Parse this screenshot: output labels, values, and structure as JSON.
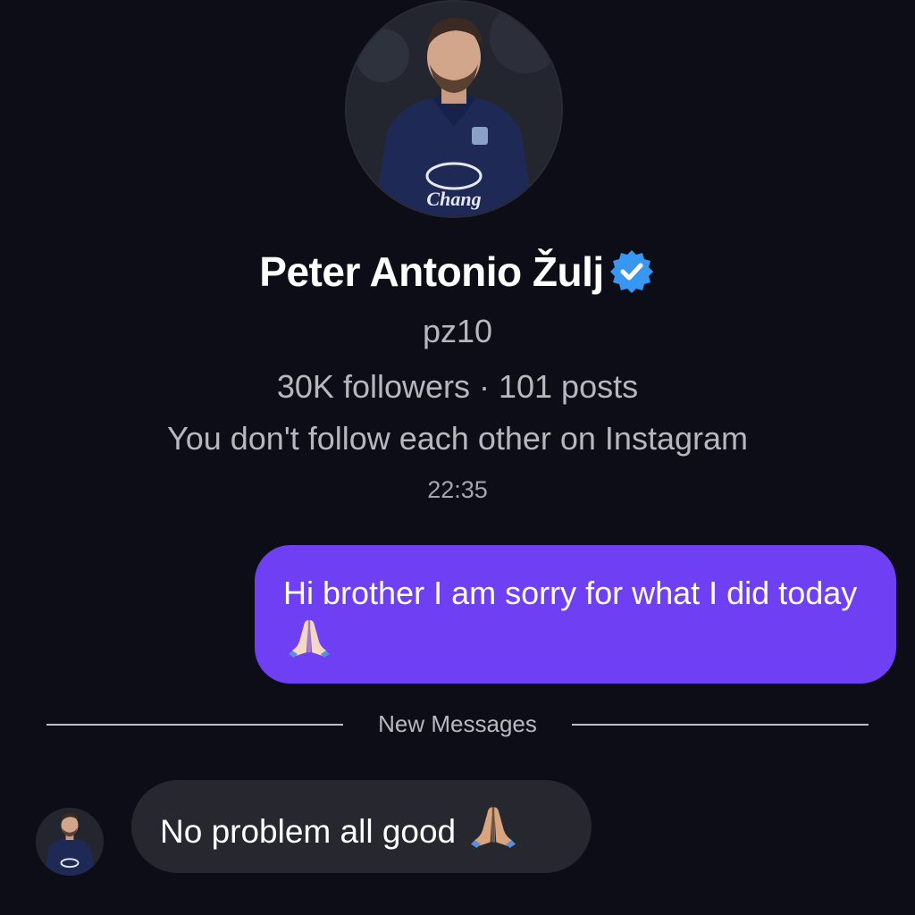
{
  "profile": {
    "name": "Peter Antonio Žulj",
    "verified": true,
    "username": "pz10",
    "stats": "30K followers · 101 posts",
    "follow_status": "You don't follow each other on Instagram"
  },
  "thread": {
    "timestamp": "22:35",
    "new_messages_label": "New Messages",
    "messages": [
      {
        "direction": "sent",
        "text": "Hi brother I am sorry for what I did today",
        "emoji": "folded-hands"
      },
      {
        "direction": "received",
        "text": "No problem all good",
        "emoji": "folded-hands"
      }
    ]
  },
  "colors": {
    "background": "#0c0d16",
    "sent_bubble": "#6e3ff3",
    "received_bubble": "#26272f",
    "verified_badge": "#3897f0",
    "secondary_text": "#b7b8be"
  }
}
